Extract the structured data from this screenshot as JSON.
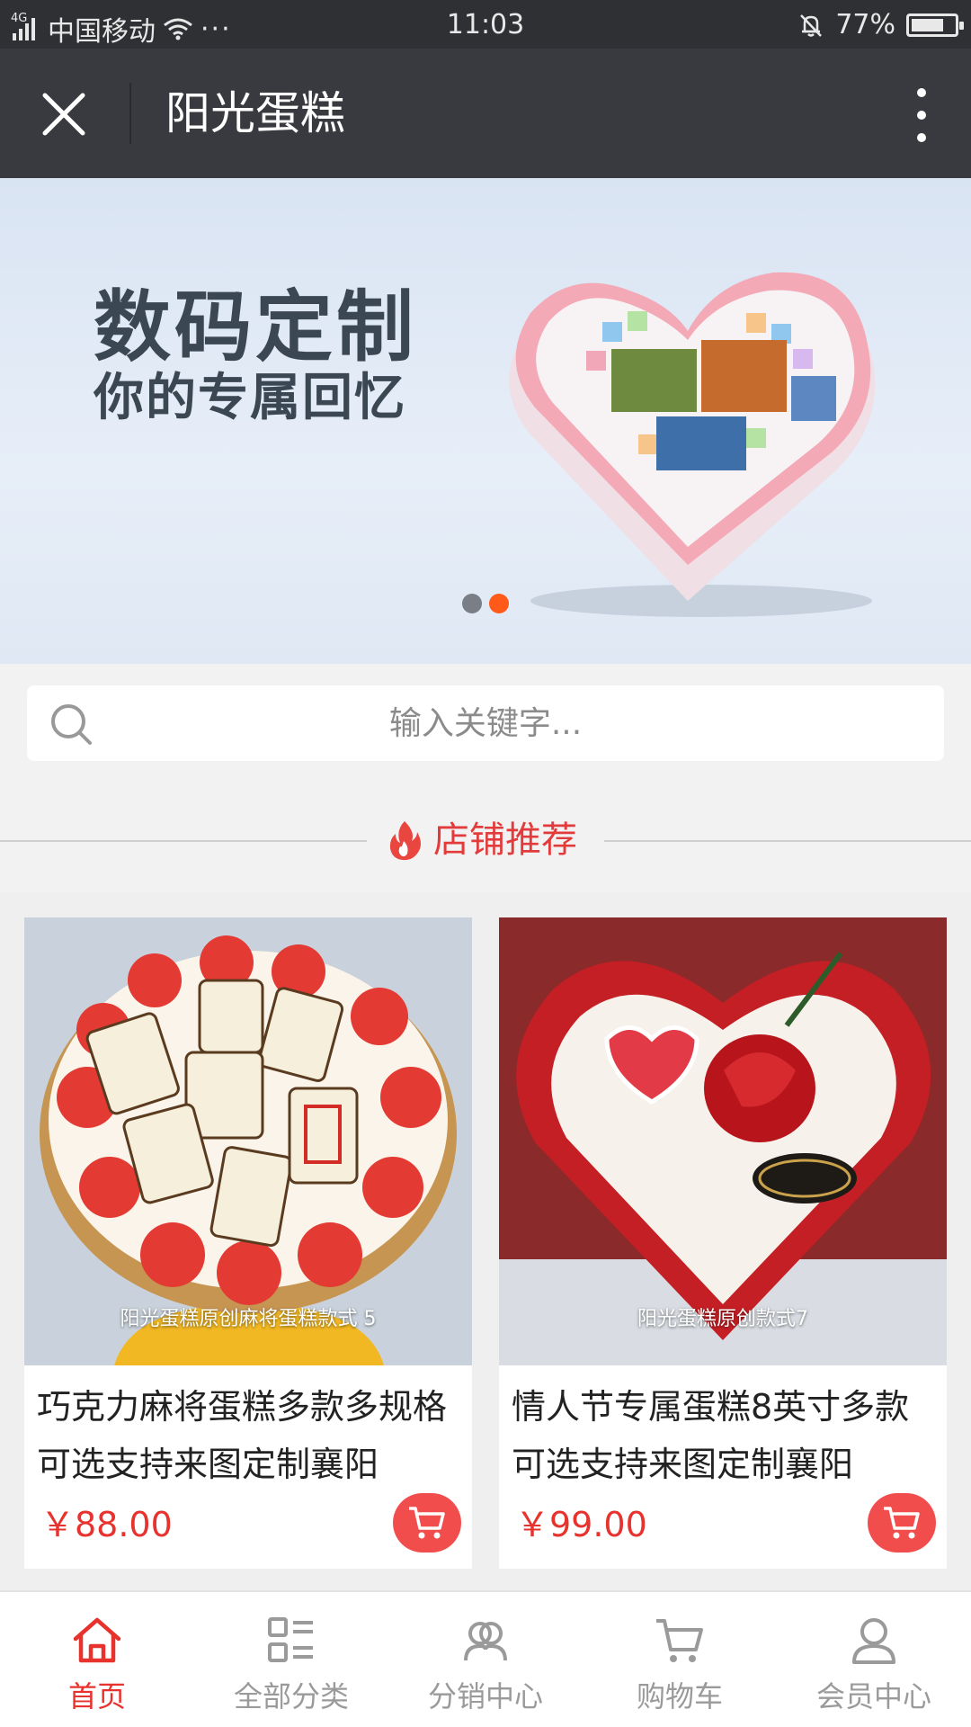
{
  "status_bar": {
    "network": "4G",
    "carrier": "中国移动",
    "extra": "···",
    "time": "11:03",
    "battery": "77%",
    "battery_level": 0.77
  },
  "header": {
    "title": "阳光蛋糕",
    "close_icon": "close-icon",
    "more_icon": "more-vertical-icon"
  },
  "banner": {
    "headline": "数码定制",
    "subheadline": "你的专属回忆",
    "slide_count": 2,
    "active_slide": 2
  },
  "search": {
    "placeholder": "输入关键字..."
  },
  "section": {
    "title": "店铺推荐",
    "icon": "flame-icon",
    "accent": "#e33b3b"
  },
  "products": [
    {
      "image_caption": "阳光蛋糕原创麻将蛋糕款式 5",
      "name": "巧克力麻将蛋糕多款多规格可选支持来图定制襄阳",
      "price": "￥88.00"
    },
    {
      "image_caption": "阳光蛋糕原创款式7",
      "name": "情人节专属蛋糕8英寸多款可选支持来图定制襄阳",
      "price": "￥99.00"
    }
  ],
  "bottom_nav": [
    {
      "label": "首页",
      "icon": "home-icon",
      "active": true
    },
    {
      "label": "全部分类",
      "icon": "category-list-icon",
      "active": false
    },
    {
      "label": "分销中心",
      "icon": "people-icon",
      "active": false
    },
    {
      "label": "购物车",
      "icon": "cart-icon",
      "active": false
    },
    {
      "label": "会员中心",
      "icon": "user-icon",
      "active": false
    }
  ],
  "colors": {
    "primary_red": "#e8322e",
    "header_bg": "#393a3f",
    "status_bg": "#2f3033",
    "banner_dot_active": "#ff5a1a"
  }
}
